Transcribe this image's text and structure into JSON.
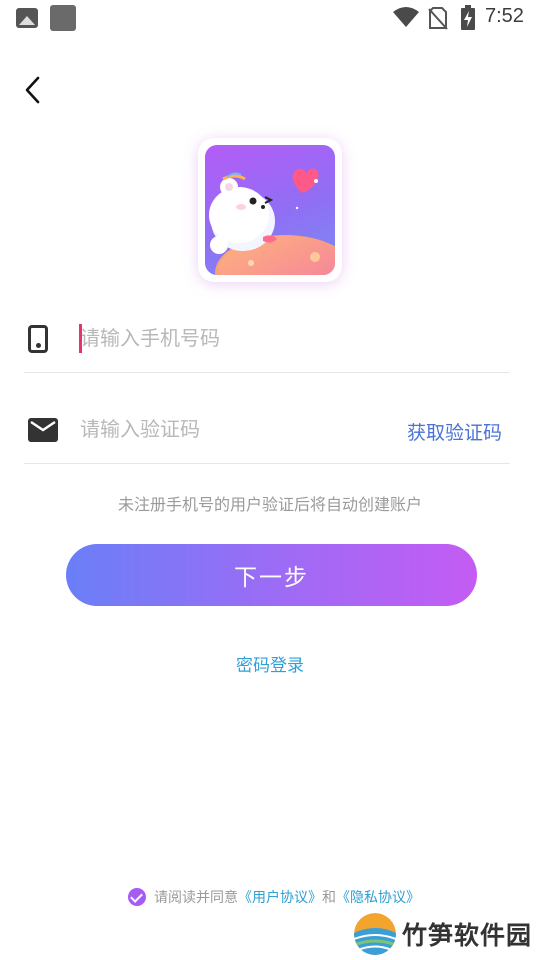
{
  "status_bar": {
    "time": "7:52",
    "icons": [
      "image-icon",
      "square-notification-icon",
      "wifi-icon",
      "no-sim-icon",
      "battery-charging-icon"
    ]
  },
  "header": {
    "back_icon": "chevron-left-icon"
  },
  "logo": {
    "description_icon": "app-logo-bear-icon"
  },
  "form": {
    "phone_placeholder": "请输入手机号码",
    "phone_value": "",
    "code_placeholder": "请输入验证码",
    "code_value": "",
    "get_code_label": "获取验证码",
    "phone_icon": "phone-icon",
    "mail_icon": "mail-icon"
  },
  "hint": "未注册手机号的用户验证后将自动创建账户",
  "next_button_label": "下一步",
  "password_login_label": "密码登录",
  "agreement": {
    "prefix": "请阅读并同意",
    "user_agreement": "《用户协议》",
    "and": "和",
    "privacy_policy": "《隐私协议》",
    "checked": true
  },
  "watermark": {
    "text": "竹笋软件园"
  },
  "colors": {
    "accent_blue": "#4a72d8",
    "link_blue": "#2e9fd3",
    "gradient_start": "#6a7ff7",
    "gradient_end": "#c45cf3",
    "caret": "#e8326b",
    "check_purple": "#a45cf4"
  }
}
